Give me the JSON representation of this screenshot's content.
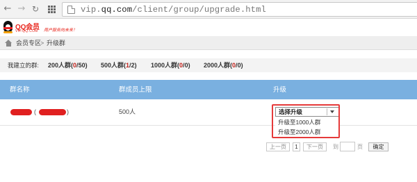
{
  "browser": {
    "url_host": "vip.qq.com",
    "url_prefix": "vip.",
    "url_domain": "qq.com",
    "url_path": "/client/group/upgrade.html",
    "icons": [
      "back-arrow-icon",
      "forward-arrow-icon",
      "reload-icon",
      "apps-grid-icon",
      "page-icon"
    ]
  },
  "site": {
    "logo_text": "QQ会员",
    "logo_sub": "VIP.QQ.COM",
    "slogan": "用户服务向未来！"
  },
  "breadcrumb": {
    "home": "会员专区",
    "separator": ">",
    "current": "升级群"
  },
  "summary": {
    "label": "我建立的群:",
    "groups": [
      {
        "name": "200人群",
        "used": "0",
        "total": "50"
      },
      {
        "name": "500人群",
        "used": "1",
        "total": "2"
      },
      {
        "name": "1000人群",
        "used": "0",
        "total": "0"
      },
      {
        "name": "2000人群",
        "used": "0",
        "total": "0"
      }
    ]
  },
  "table": {
    "headers": [
      "群名称",
      "群成员上限",
      "升级"
    ],
    "rows": [
      {
        "name_open": "(",
        "name_close": ")",
        "limit": "500人"
      }
    ]
  },
  "upgrade_select": {
    "selected": "选择升级",
    "options": [
      "升级至1000人群",
      "升级至2000人群"
    ]
  },
  "pagination": {
    "prev": "上一页",
    "current_page": "1",
    "next": "下一页",
    "jump_label": "到",
    "page_label": "页",
    "confirm": "确定"
  },
  "colors": {
    "table_header_bg": "#7ab0e0",
    "accent_red": "#c0201a",
    "highlight_border": "#e53a3a"
  }
}
